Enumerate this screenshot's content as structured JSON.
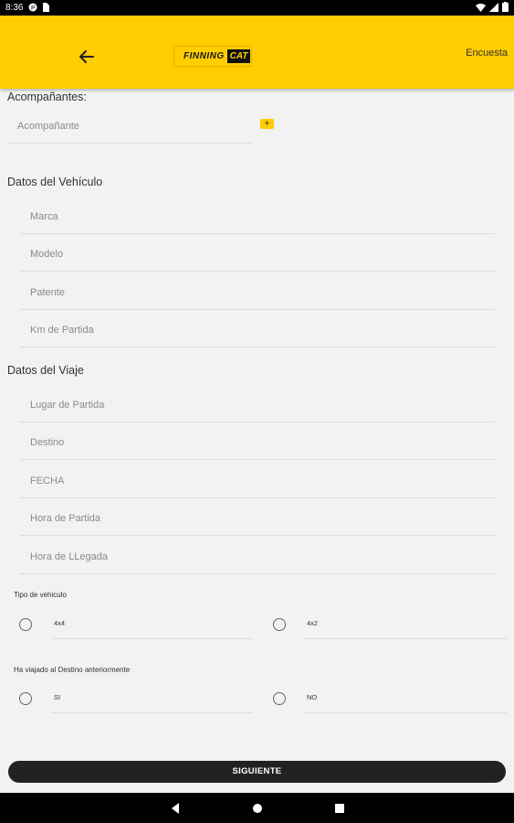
{
  "status_bar": {
    "time": "8:36"
  },
  "app_bar": {
    "logo_text": "FINNING",
    "logo_badge": "CAT",
    "action_label": "Encuesta",
    "brand_color": "#ffcd00"
  },
  "acompanantes": {
    "title": "Acompañantes:",
    "placeholder": "Acompañante",
    "add_label": "+"
  },
  "vehiculo": {
    "title": "Datos del Vehículo",
    "fields": {
      "marca": "Marca",
      "modelo": "Modelo",
      "patente": "Patente",
      "km": "Km de Partida"
    }
  },
  "viaje": {
    "title": "Datos del Viaje",
    "fields": {
      "lugar": "Lugar de Partida",
      "destino": "Destino",
      "fecha": "FECHA",
      "hora_partida": "Hora de Partida",
      "hora_llegada": "Hora de LLegada"
    }
  },
  "tipo_vehiculo": {
    "label": "Tipo de vehiculo",
    "options": [
      "4x4",
      "4x2"
    ]
  },
  "viajado": {
    "label": "Ha viajado al Destino anteriormente",
    "options": [
      "SI",
      "NO"
    ]
  },
  "footer": {
    "next_label": "SIGUIENTE"
  }
}
